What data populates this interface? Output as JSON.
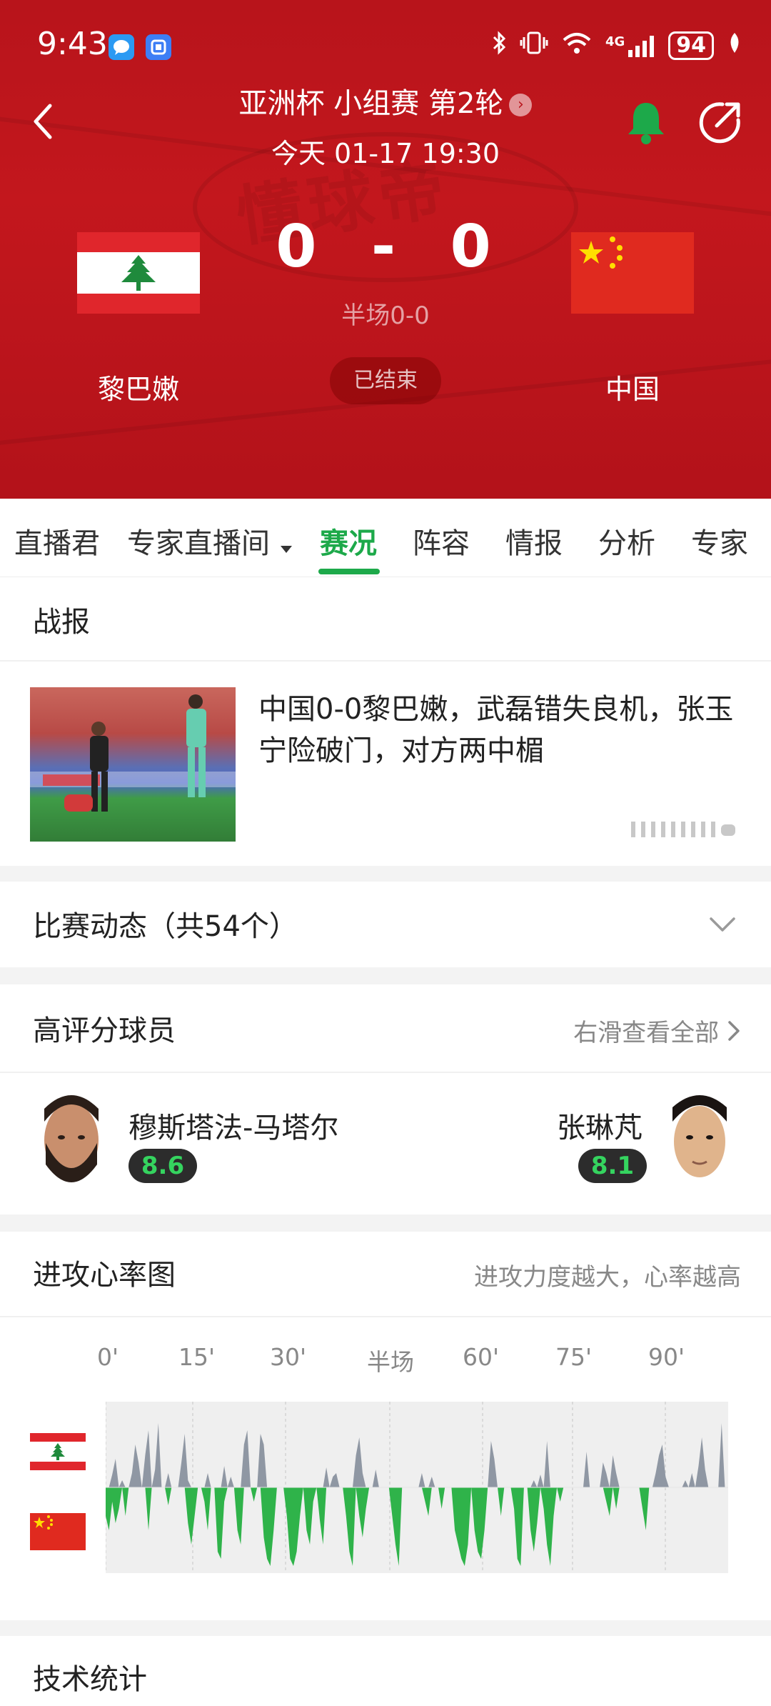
{
  "status_bar": {
    "time": "9:43",
    "network": "4G",
    "battery": "94"
  },
  "header": {
    "league": "亚洲杯 小组赛 第2轮",
    "time": "今天 01-17 19:30",
    "home_team": "黎巴嫩",
    "away_team": "中国",
    "home_score": "0",
    "away_score": "0",
    "score_sep": "-",
    "halftime": "半场0-0",
    "status": "已结束",
    "watermark": "懂球帝",
    "bell_color": "#1da94a"
  },
  "tabs": [
    "直播君",
    "专家直播间",
    "赛况",
    "阵容",
    "情报",
    "分析",
    "专家"
  ],
  "active_tab": "赛况",
  "news": {
    "section": "战报",
    "title": "中国0-0黎巴嫩，武磊错失良机，张玉宁险破门，对方两中楣"
  },
  "events": {
    "label": "比赛动态（共54个）"
  },
  "top_players": {
    "title": "高评分球员",
    "more": "右滑查看全部",
    "home": {
      "name": "穆斯塔法-马塔尔",
      "rating": "8.6"
    },
    "away": {
      "name": "张琳芃",
      "rating": "8.1"
    }
  },
  "heart_rate": {
    "title": "进攻心率图",
    "subtitle": "进攻力度越大，心率越高",
    "ticks": [
      "0'",
      "15'",
      "30'",
      "半场",
      "60'",
      "75'",
      "90'"
    ],
    "home_color": "#8f97a3",
    "away_color": "#2fb34a"
  },
  "tech_stats": {
    "title": "技术统计"
  }
}
